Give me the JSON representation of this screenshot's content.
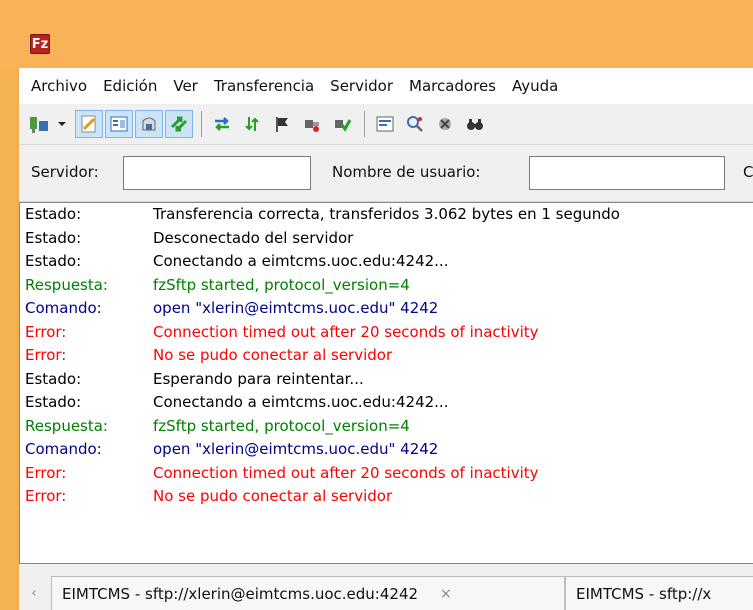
{
  "window": {
    "logo_text": "Fz"
  },
  "menu": [
    "Archivo",
    "Edición",
    "Ver",
    "Transferencia",
    "Servidor",
    "Marcadores",
    "Ayuda"
  ],
  "toolbar": {
    "icons": [
      "site-manager-icon",
      "dropdown-arrow-icon",
      "message-log-toggle-icon",
      "local-tree-toggle-icon",
      "remote-tree-toggle-icon",
      "transfer-queue-toggle-icon",
      "refresh-icon",
      "process-queue-icon",
      "cancel-operation-icon",
      "disconnect-icon",
      "reconnect-icon",
      "directory-listing-filter-icon",
      "toggle-sync-browsing-icon",
      "directory-comparison-icon",
      "search-remote-icon"
    ]
  },
  "quickconnect": {
    "host_label": "Servidor:",
    "host_value": "",
    "user_label": "Nombre de usuario:",
    "user_value": "",
    "next_label_partial": "C"
  },
  "log": [
    {
      "label": "Estado:",
      "message": "Transferencia correcta, transferidos 3.062 bytes en 1 segundo",
      "type": "status"
    },
    {
      "label": "Estado:",
      "message": "Desconectado del servidor",
      "type": "status"
    },
    {
      "label": "Estado:",
      "message": "Conectando a eimtcms.uoc.edu:4242...",
      "type": "status"
    },
    {
      "label": "Respuesta:",
      "message": "fzSftp started, protocol_version=4",
      "type": "response"
    },
    {
      "label": "Comando:",
      "message": "open \"xlerin@eimtcms.uoc.edu\" 4242",
      "type": "command"
    },
    {
      "label": "Error:",
      "message": "Connection timed out after 20 seconds of inactivity",
      "type": "error"
    },
    {
      "label": "Error:",
      "message": "No se pudo conectar al servidor",
      "type": "error"
    },
    {
      "label": "Estado:",
      "message": "Esperando para reintentar...",
      "type": "status"
    },
    {
      "label": "Estado:",
      "message": "Conectando a eimtcms.uoc.edu:4242...",
      "type": "status"
    },
    {
      "label": "Respuesta:",
      "message": "fzSftp started, protocol_version=4",
      "type": "response"
    },
    {
      "label": "Comando:",
      "message": "open \"xlerin@eimtcms.uoc.edu\" 4242",
      "type": "command"
    },
    {
      "label": "Error:",
      "message": "Connection timed out after 20 seconds of inactivity",
      "type": "error"
    },
    {
      "label": "Error:",
      "message": "No se pudo conectar al servidor",
      "type": "error"
    }
  ],
  "log_colors": {
    "status": "#000000",
    "response": "#008000",
    "command": "#00008b",
    "error": "#ff0000"
  },
  "tabs": [
    {
      "label": "EIMTCMS - sftp://xlerin@eimtcms.uoc.edu:4242",
      "close": "×"
    },
    {
      "label": "EIMTCMS - sftp://x"
    }
  ],
  "tab_scroll_icon": "‹"
}
